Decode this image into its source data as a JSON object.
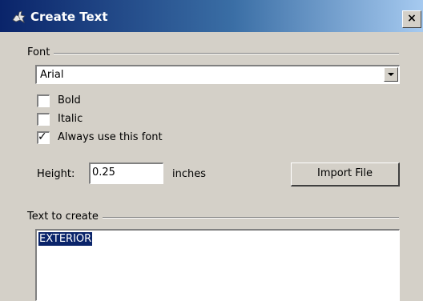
{
  "window": {
    "title": "Create Text",
    "close_glyph": "×",
    "icon": "rhino-app-icon"
  },
  "font_group": {
    "label": "Font",
    "selected_font": "Arial",
    "bold": {
      "label": "Bold",
      "checked": false
    },
    "italic": {
      "label": "Italic",
      "checked": false
    },
    "always_use": {
      "label": "Always use this font",
      "checked": true,
      "mark": "✓"
    }
  },
  "height": {
    "label": "Height:",
    "value": "0.25",
    "unit": "inches"
  },
  "import_button": {
    "label": "Import File"
  },
  "text_group": {
    "label": "Text to create",
    "content": "EXTERIOR"
  },
  "colors": {
    "titlebar_start": "#0a246a",
    "titlebar_end": "#a6caf0",
    "dialog_bg": "#d4d0c8",
    "selection_bg": "#0a246a"
  }
}
